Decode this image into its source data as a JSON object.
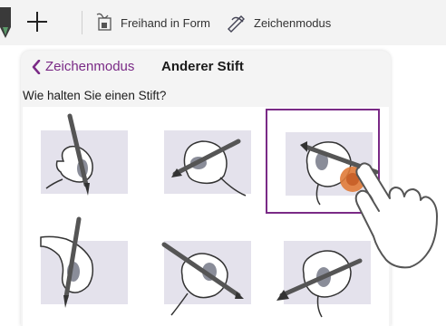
{
  "toolbar": {
    "freehand_label": "Freihand in Form",
    "drawmode_label": "Zeichenmodus"
  },
  "panel": {
    "back_label": "Zeichenmodus",
    "title": "Anderer Stift",
    "question": "Wie halten Sie einen Stift?"
  },
  "options": [
    {
      "icon": "pen-grip-vertical-fist",
      "selected": false
    },
    {
      "icon": "pen-grip-diagonal-left",
      "selected": false
    },
    {
      "icon": "pen-grip-diagonal-right",
      "selected": true
    },
    {
      "icon": "pen-grip-vertical-hook",
      "selected": false
    },
    {
      "icon": "pen-grip-diagonal-down",
      "selected": false
    },
    {
      "icon": "pen-grip-diagonal-up",
      "selected": false
    }
  ],
  "colors": {
    "accent": "#7a2a86",
    "tap_indicator": "#e07b39"
  }
}
